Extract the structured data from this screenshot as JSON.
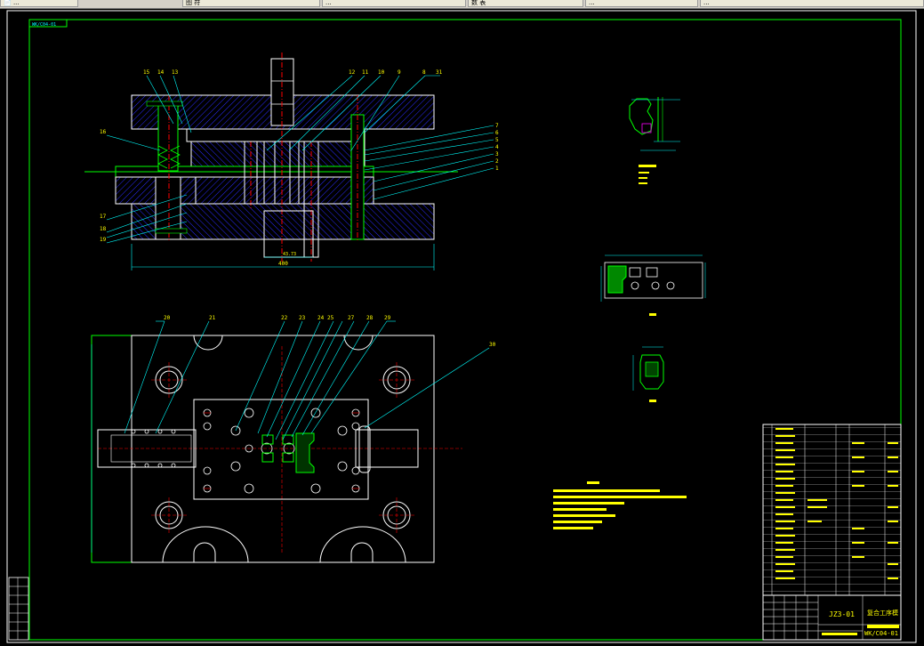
{
  "tabs": [
    {
      "label": "📄 ..."
    },
    {
      "label": "图 符"
    },
    {
      "label": "..."
    },
    {
      "label": "数 表"
    },
    {
      "label": "..."
    },
    {
      "label": "..."
    }
  ],
  "drawing": {
    "sheet_tag": "WK/C04-01",
    "section_view": {
      "dim_bottom": "400",
      "dim_inner": "43.73",
      "callouts_top": [
        "15",
        "14",
        "13",
        "12",
        "11",
        "10",
        "9",
        "8",
        "31"
      ],
      "callouts_right": [
        "7",
        "6",
        "5",
        "4",
        "3",
        "2",
        "1"
      ],
      "callouts_left": [
        "16",
        "17",
        "18",
        "19"
      ]
    },
    "plan_view": {
      "callouts": [
        "20",
        "21",
        "22",
        "23",
        "24",
        "25",
        "27",
        "28",
        "29",
        "30"
      ]
    },
    "title_block": {
      "drawing_number": "WK/C04-01",
      "label": "JZ3-01",
      "name": "复合工序模"
    },
    "colors": {
      "outline": "#ffffff",
      "frame": "#00ff00",
      "dimension": "#00ffff",
      "hatch": "#0000ff",
      "center": "#ff0000",
      "parts": "#00ff00",
      "text": "#ffff00",
      "magenta": "#ff00ff"
    }
  }
}
